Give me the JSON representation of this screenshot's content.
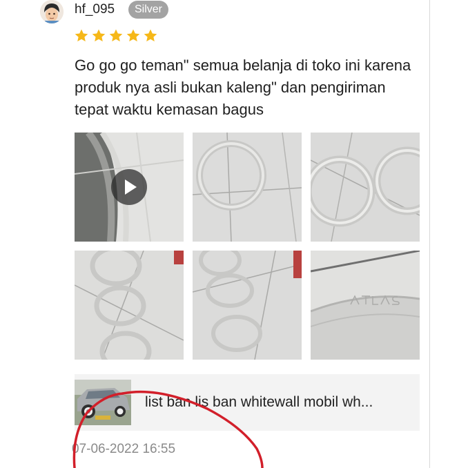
{
  "review": {
    "username": "hf_095",
    "badge": "Silver",
    "rating": 5,
    "text": "Go go go teman\" semua belanja di toko ini karena produk nya asli bukan kaleng\" dan pengiriman tepat waktu kemasan bagus",
    "media_count": 6,
    "first_media_is_video": true,
    "timestamp": "07-06-2022 16:55"
  },
  "product": {
    "name": "list ban lis ban whitewall mobil wh..."
  },
  "colors": {
    "star": "#f6b819",
    "badge": "#a3a3a3",
    "annotation": "#d21f2a"
  },
  "icons": {
    "play": "play-icon",
    "star": "star-icon"
  }
}
